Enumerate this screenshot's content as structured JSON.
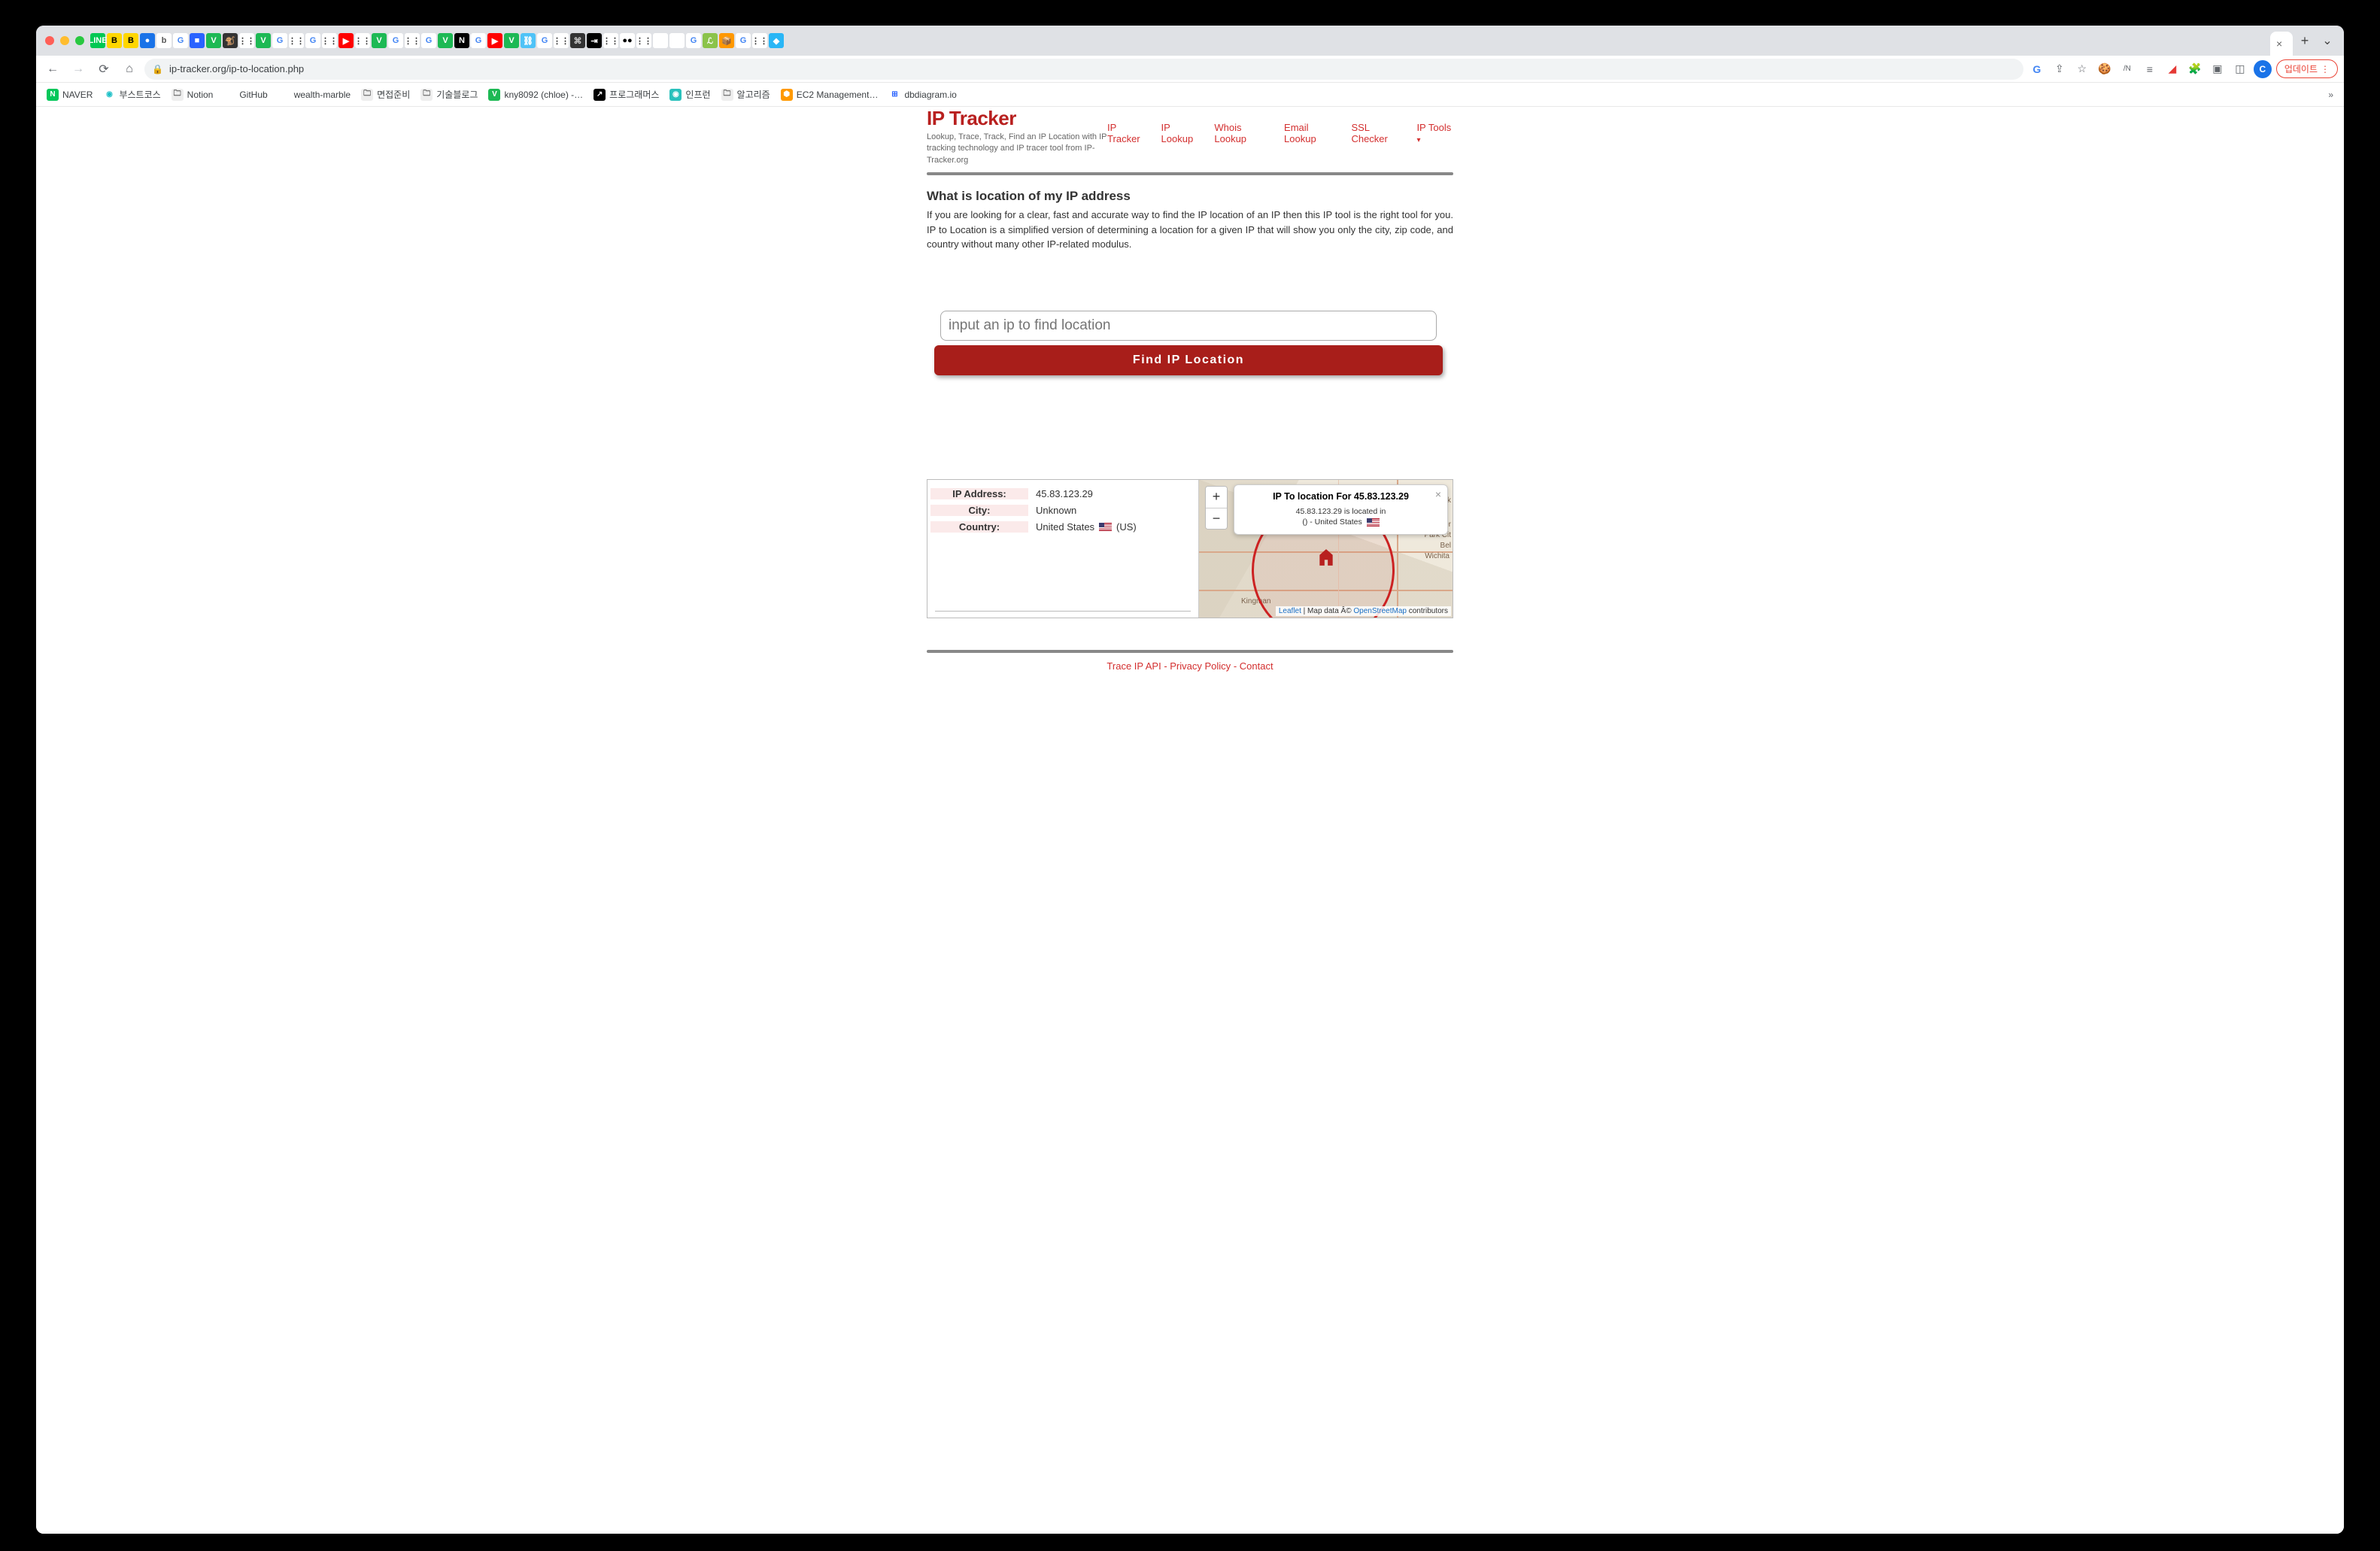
{
  "browser": {
    "url": "ip-tracker.org/ip-to-location.php",
    "update_label": "업데이트",
    "avatar_letter": "C",
    "tab_icons": [
      {
        "bg": "#00c853",
        "fg": "#fff",
        "t": "LINE"
      },
      {
        "bg": "#ffd600",
        "fg": "#000",
        "t": "B"
      },
      {
        "bg": "#ffd600",
        "fg": "#000",
        "t": "B"
      },
      {
        "bg": "#1a73e8",
        "fg": "#fff",
        "t": "●"
      },
      {
        "bg": "#fff",
        "fg": "#555",
        "t": "b"
      },
      {
        "bg": "#fff",
        "fg": "#4285f4",
        "t": "G"
      },
      {
        "bg": "#2962ff",
        "fg": "#fff",
        "t": "■"
      },
      {
        "bg": "#1db954",
        "fg": "#fff",
        "t": "V"
      },
      {
        "bg": "#333",
        "fg": "#ddd",
        "t": "🐒"
      },
      {
        "bg": "#fff",
        "fg": "#333",
        "t": "⋮⋮"
      },
      {
        "bg": "#1db954",
        "fg": "#fff",
        "t": "V"
      },
      {
        "bg": "#fff",
        "fg": "#4285f4",
        "t": "G"
      },
      {
        "bg": "#fff",
        "fg": "#333",
        "t": "⋮⋮"
      },
      {
        "bg": "#fff",
        "fg": "#4285f4",
        "t": "G"
      },
      {
        "bg": "#fff",
        "fg": "#333",
        "t": "⋮⋮"
      },
      {
        "bg": "#ff0000",
        "fg": "#fff",
        "t": "▶"
      },
      {
        "bg": "#fff",
        "fg": "#333",
        "t": "⋮⋮"
      },
      {
        "bg": "#1db954",
        "fg": "#fff",
        "t": "V"
      },
      {
        "bg": "#fff",
        "fg": "#4285f4",
        "t": "G"
      },
      {
        "bg": "#fff",
        "fg": "#333",
        "t": "⋮⋮"
      },
      {
        "bg": "#fff",
        "fg": "#4285f4",
        "t": "G"
      },
      {
        "bg": "#1db954",
        "fg": "#fff",
        "t": "V"
      },
      {
        "bg": "#000",
        "fg": "#fff",
        "t": "N"
      },
      {
        "bg": "#fff",
        "fg": "#4285f4",
        "t": "G"
      },
      {
        "bg": "#ff0000",
        "fg": "#fff",
        "t": "▶"
      },
      {
        "bg": "#1db954",
        "fg": "#fff",
        "t": "V"
      },
      {
        "bg": "#4fc3f7",
        "fg": "#fff",
        "t": "⛓"
      },
      {
        "bg": "#fff",
        "fg": "#4285f4",
        "t": "G"
      },
      {
        "bg": "#fff",
        "fg": "#333",
        "t": "⋮⋮"
      },
      {
        "bg": "#333",
        "fg": "#ccc",
        "t": "⌘"
      },
      {
        "bg": "#000",
        "fg": "#fff",
        "t": "⇥"
      },
      {
        "bg": "#fff",
        "fg": "#333",
        "t": "⋮⋮"
      },
      {
        "bg": "#fff",
        "fg": "#000",
        "t": "●●"
      },
      {
        "bg": "#fff",
        "fg": "#333",
        "t": "⋮⋮"
      },
      {
        "bg": "#fff",
        "fg": "#000",
        "t": ""
      },
      {
        "bg": "#fff",
        "fg": "#000",
        "t": ""
      },
      {
        "bg": "#fff",
        "fg": "#4285f4",
        "t": "G"
      },
      {
        "bg": "#8bc34a",
        "fg": "#fff",
        "t": "ℒ"
      },
      {
        "bg": "#ff9800",
        "fg": "#fff",
        "t": "📦"
      },
      {
        "bg": "#fff",
        "fg": "#4285f4",
        "t": "G"
      },
      {
        "bg": "#fff",
        "fg": "#333",
        "t": "⋮⋮"
      },
      {
        "bg": "#29b6f6",
        "fg": "#fff",
        "t": "◆"
      }
    ]
  },
  "bookmarks": [
    {
      "label": "NAVER",
      "bg": "#03c75a",
      "fg": "#fff",
      "t": "N"
    },
    {
      "label": "부스트코스",
      "bg": "#fff",
      "fg": "#1ec0c7",
      "t": "◉"
    },
    {
      "label": "Notion",
      "bg": "#eee",
      "fg": "#555",
      "t": "🗀"
    },
    {
      "label": "GitHub",
      "bg": "#fff",
      "fg": "#000",
      "t": ""
    },
    {
      "label": "wealth-marble",
      "bg": "#fff",
      "fg": "#000",
      "t": ""
    },
    {
      "label": "면접준비",
      "bg": "#eee",
      "fg": "#555",
      "t": "🗀"
    },
    {
      "label": "기술블로그",
      "bg": "#eee",
      "fg": "#555",
      "t": "🗀"
    },
    {
      "label": "kny8092 (chloe) -…",
      "bg": "#1db954",
      "fg": "#fff",
      "t": "V"
    },
    {
      "label": "프로그래머스",
      "bg": "#000",
      "fg": "#fff",
      "t": "↗"
    },
    {
      "label": "인프런",
      "bg": "#2ac1bc",
      "fg": "#fff",
      "t": "◉"
    },
    {
      "label": "알고리즘",
      "bg": "#eee",
      "fg": "#555",
      "t": "🗀"
    },
    {
      "label": "EC2 Management…",
      "bg": "#ff9900",
      "fg": "#fff",
      "t": "⬢"
    },
    {
      "label": "dbdiagram.io",
      "bg": "#fff",
      "fg": "#2962ff",
      "t": "⊞"
    }
  ],
  "page": {
    "logo": "IP Tracker",
    "subtitle": "Lookup, Trace, Track, Find an IP Location with IP tracking technology and IP tracer tool from IP-Tracker.org",
    "nav": [
      "IP Tracker",
      "IP Lookup",
      "Whois Lookup",
      "Email Lookup",
      "SSL Checker",
      "IP Tools"
    ],
    "section_title": "What is location of my IP address",
    "section_desc": "If you are looking for a clear, fast and accurate way to find the IP location of an IP then this IP tool is the right tool for you. IP to Location is a simplified version of determining a location for a given IP that will show you only the city, zip code, and country without many other IP-related modulus.",
    "input_placeholder": "input an ip to find location",
    "button_label": "Find IP Location",
    "result": {
      "labels": {
        "ip": "IP Address:",
        "city": "City:",
        "country": "Country:"
      },
      "ip": "45.83.123.29",
      "city": "Unknown",
      "country": "United States",
      "country_code": "(US)"
    },
    "map": {
      "popup_title": "IP To location For 45.83.123.29",
      "popup_line1": "45.83.123.29 is located in",
      "popup_line2": "() - United States",
      "cities": {
        "wichita": "Wichita",
        "kingman": "Kingman",
        "sedgwick": "dgwick",
        "valley": "alley Center",
        "park": "Park Cit",
        "bel": "Bel"
      },
      "zoom_in": "+",
      "zoom_out": "−",
      "attr_leaflet": "Leaflet",
      "attr_mid": " | Map data Â© ",
      "attr_osm": "OpenStreetMap",
      "attr_end": " contributors"
    },
    "footer": {
      "api": "Trace IP API",
      "privacy": "Privacy Policy",
      "contact": "Contact",
      "sep": " - "
    }
  }
}
